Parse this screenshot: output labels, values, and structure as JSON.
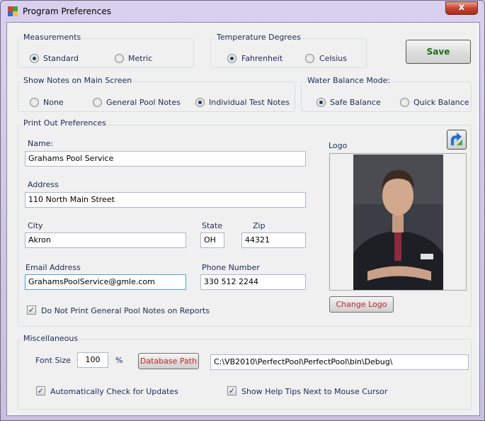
{
  "window": {
    "title": "Program Preferences",
    "close_glyph": "x"
  },
  "measurements": {
    "label": "Measurements",
    "standard": "Standard",
    "metric": "Metric",
    "selected": "standard"
  },
  "temperature": {
    "label": "Temperature Degrees",
    "fahrenheit": "Fahrenheit",
    "celsius": "Celsius",
    "selected": "fahrenheit"
  },
  "save_label": "Save",
  "notes": {
    "label": "Show Notes on Main Screen",
    "none": "None",
    "general": "General Pool Notes",
    "individual": "Individual Test Notes",
    "selected": "individual"
  },
  "water_balance": {
    "label": "Water Balance Mode:",
    "safe": "Safe Balance",
    "quick": "Quick Balance",
    "selected": "safe"
  },
  "printout": {
    "label": "Print Out Preferences",
    "name_label": "Name:",
    "name_value": "Grahams Pool Service",
    "address_label": "Address",
    "address_value": "110 North Main Street",
    "city_label": "City",
    "city_value": "Akron",
    "state_label": "State",
    "state_value": "OH",
    "zip_label": "Zip",
    "zip_value": "44321",
    "email_label": "Email Address",
    "email_value": "GrahamsPoolService@gmle.com",
    "phone_label": "Phone Number",
    "phone_value": "330 512 2244",
    "no_print_label": "Do Not Print General Pool Notes on Reports",
    "no_print_checked": true,
    "logo_label": "Logo",
    "change_logo_label": "Change Logo"
  },
  "misc": {
    "label": "Miscellaneous",
    "font_size_label": "Font Size",
    "font_size_value": "100",
    "percent": "%",
    "database_path_label": "Database Path",
    "database_path_value": "C:\\VB2010\\PerfectPool\\PerfectPool\\bin\\Debug\\",
    "auto_update_label": "Automatically Check for Updates",
    "auto_update_checked": true,
    "help_tips_label": "Show Help Tips Next to Mouse Cursor",
    "help_tips_checked": true
  },
  "colors": {
    "save_text": "#1e6b1e",
    "red_button_text": "#c0282a",
    "label_navy": "#1b2a5a"
  },
  "icons": {
    "app": "app-icon",
    "rotate": "rotate-arrow-icon",
    "close": "close-icon"
  }
}
